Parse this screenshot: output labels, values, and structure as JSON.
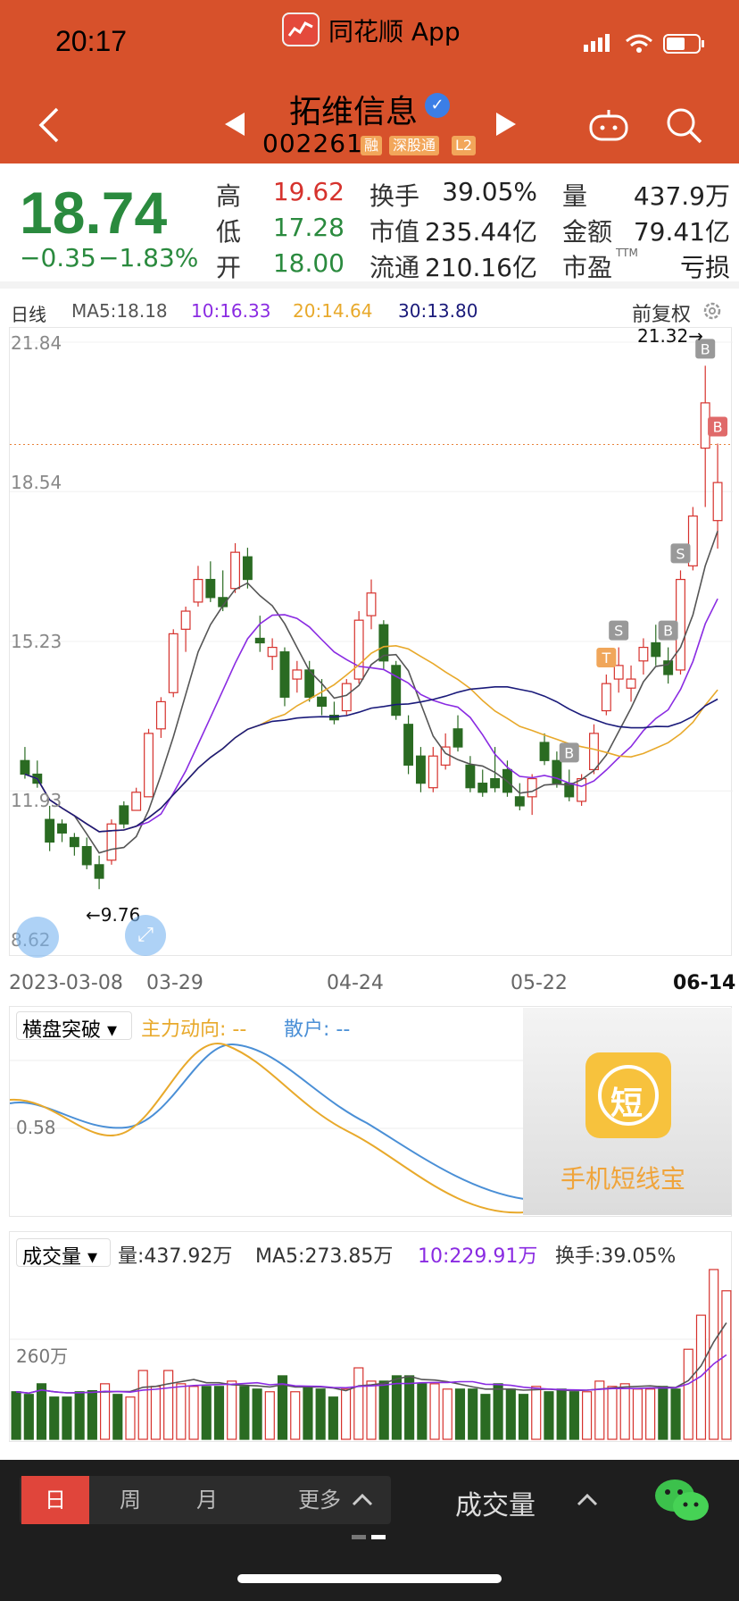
{
  "status_bar": {
    "time": "20:17",
    "app_name": "同花顺 App"
  },
  "header": {
    "stock_name": "拓维信息",
    "stock_code": "002261",
    "tags": [
      "融",
      "深股通",
      "L2"
    ],
    "verified_icon": "check-badge-icon"
  },
  "quote": {
    "price": "18.74",
    "change": "−0.35",
    "change_pct": "−1.83%",
    "high_label": "高",
    "high": "19.62",
    "low_label": "低",
    "low": "17.28",
    "open_label": "开",
    "open": "18.00",
    "turnover_label": "换手",
    "turnover": "39.05%",
    "mktcap_label": "市值",
    "mktcap": "235.44亿",
    "float_label": "流通",
    "float": "210.16亿",
    "volume_label": "量",
    "volume": "437.9万",
    "amount_label": "金额",
    "amount": "79.41亿",
    "pe_label": "市盈",
    "pe_sup": "TTM",
    "pe": "亏损"
  },
  "kline": {
    "period": "日线",
    "ma5": "MA5:18.18",
    "ma10": "10:16.33",
    "ma20": "20:14.64",
    "ma30": "30:13.80",
    "adjust": "前复权",
    "y_ticks": [
      "21.84",
      "18.54",
      "15.23",
      "11.93",
      "8.62"
    ],
    "x_ticks": [
      "2023-03-08",
      "03-29",
      "04-24",
      "05-22",
      "06-14"
    ],
    "max_label": "21.32→",
    "min_label": "←9.76",
    "reference_price": "18.74"
  },
  "indicator": {
    "name": "横盘突破",
    "main_label": "主力动向: --",
    "retail_label": "散户: --",
    "level": "0.58",
    "ad_text": "手机短线宝",
    "ad_icon_char": "短"
  },
  "volume": {
    "name": "成交量",
    "vol": "量:437.92万",
    "ma5": "MA5:273.85万",
    "ma10": "10:229.91万",
    "turnover": "换手:39.05%",
    "axis_label": "260万"
  },
  "footer": {
    "periods": [
      "日",
      "周",
      "月",
      "更多"
    ],
    "indicator_label": "成交量"
  },
  "colors": {
    "up": "#d6322d",
    "down": "#2a6b22",
    "ma5": "#555555",
    "ma10": "#8a2be2",
    "ma20": "#e8a92b",
    "ma30": "#1a1a7a",
    "header": "#d7512b"
  },
  "chart_data": {
    "type": "candlestick",
    "dates_first": "2023-03-08",
    "dates_last": "06-14",
    "ylim": [
      8.62,
      21.84
    ],
    "candles": [
      [
        12.6,
        12.9,
        12.2,
        12.3
      ],
      [
        12.3,
        12.6,
        12.0,
        12.1
      ],
      [
        11.3,
        11.6,
        10.6,
        10.8
      ],
      [
        11.2,
        11.3,
        10.8,
        11.0
      ],
      [
        10.9,
        11.0,
        10.5,
        10.7
      ],
      [
        10.7,
        10.9,
        10.2,
        10.3
      ],
      [
        10.3,
        10.5,
        9.76,
        10.0
      ],
      [
        10.4,
        11.3,
        10.3,
        11.2
      ],
      [
        11.6,
        11.7,
        11.1,
        11.2
      ],
      [
        11.5,
        12.0,
        11.5,
        11.9
      ],
      [
        11.8,
        13.3,
        11.8,
        13.2
      ],
      [
        13.3,
        14.0,
        13.1,
        13.9
      ],
      [
        14.1,
        15.5,
        14.0,
        15.4
      ],
      [
        15.5,
        16.0,
        15.0,
        15.9
      ],
      [
        16.1,
        16.9,
        16.0,
        16.6
      ],
      [
        16.6,
        17.0,
        16.1,
        16.2
      ],
      [
        16.2,
        16.8,
        15.9,
        16.0
      ],
      [
        16.4,
        17.4,
        16.3,
        17.2
      ],
      [
        17.1,
        17.3,
        16.4,
        16.6
      ],
      [
        15.3,
        15.8,
        15.0,
        15.2
      ],
      [
        14.9,
        15.3,
        14.6,
        15.1
      ],
      [
        15.0,
        15.1,
        13.8,
        14.0
      ],
      [
        14.4,
        14.8,
        14.1,
        14.6
      ],
      [
        14.6,
        14.8,
        13.9,
        14.0
      ],
      [
        14.0,
        14.4,
        13.6,
        13.8
      ],
      [
        13.6,
        13.9,
        13.4,
        13.5
      ],
      [
        13.7,
        14.4,
        13.6,
        14.3
      ],
      [
        14.4,
        15.9,
        14.3,
        15.7
      ],
      [
        15.8,
        16.6,
        15.5,
        16.3
      ],
      [
        15.6,
        15.7,
        14.6,
        14.8
      ],
      [
        14.7,
        14.8,
        13.5,
        13.6
      ],
      [
        13.4,
        13.6,
        12.3,
        12.5
      ],
      [
        12.7,
        12.9,
        11.9,
        12.1
      ],
      [
        12.0,
        12.9,
        11.9,
        12.7
      ],
      [
        12.5,
        13.2,
        12.4,
        12.9
      ],
      [
        13.3,
        13.6,
        12.8,
        12.9
      ],
      [
        12.5,
        12.7,
        11.9,
        12.0
      ],
      [
        12.1,
        12.4,
        11.8,
        11.9
      ],
      [
        12.2,
        12.9,
        11.9,
        12.0
      ],
      [
        12.4,
        12.6,
        11.8,
        11.9
      ],
      [
        11.8,
        12.1,
        11.5,
        11.6
      ],
      [
        11.8,
        12.3,
        11.4,
        12.2
      ],
      [
        13.0,
        13.2,
        12.5,
        12.6
      ],
      [
        12.6,
        12.8,
        12.0,
        12.1
      ],
      [
        12.1,
        12.4,
        11.7,
        11.8
      ],
      [
        11.7,
        12.3,
        11.6,
        12.2
      ],
      [
        12.4,
        13.4,
        12.3,
        13.2
      ],
      [
        13.7,
        14.5,
        13.6,
        14.3
      ],
      [
        14.4,
        15.1,
        14.1,
        14.7
      ],
      [
        14.2,
        14.7,
        13.9,
        14.4
      ],
      [
        14.8,
        15.3,
        14.5,
        15.1
      ],
      [
        15.2,
        15.6,
        14.7,
        14.9
      ],
      [
        14.8,
        15.1,
        14.3,
        14.5
      ],
      [
        14.6,
        16.8,
        14.5,
        16.6
      ],
      [
        16.9,
        18.2,
        16.8,
        18.0
      ],
      [
        19.5,
        21.32,
        18.2,
        20.5
      ],
      [
        17.9,
        19.6,
        17.28,
        18.74
      ]
    ]
  }
}
